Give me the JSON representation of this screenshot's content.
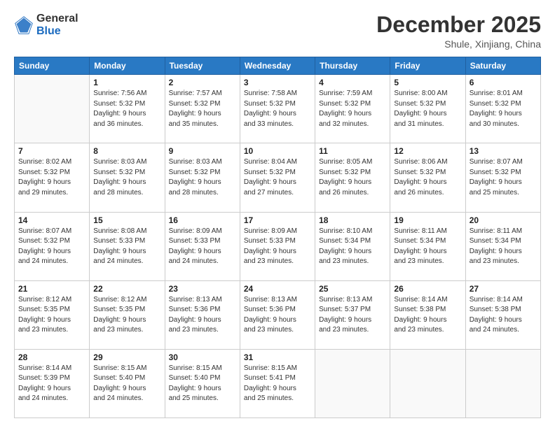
{
  "logo": {
    "general": "General",
    "blue": "Blue"
  },
  "header": {
    "month_year": "December 2025",
    "location": "Shule, Xinjiang, China"
  },
  "weekdays": [
    "Sunday",
    "Monday",
    "Tuesday",
    "Wednesday",
    "Thursday",
    "Friday",
    "Saturday"
  ],
  "weeks": [
    [
      {
        "day": "",
        "info": ""
      },
      {
        "day": "1",
        "info": "Sunrise: 7:56 AM\nSunset: 5:32 PM\nDaylight: 9 hours\nand 36 minutes."
      },
      {
        "day": "2",
        "info": "Sunrise: 7:57 AM\nSunset: 5:32 PM\nDaylight: 9 hours\nand 35 minutes."
      },
      {
        "day": "3",
        "info": "Sunrise: 7:58 AM\nSunset: 5:32 PM\nDaylight: 9 hours\nand 33 minutes."
      },
      {
        "day": "4",
        "info": "Sunrise: 7:59 AM\nSunset: 5:32 PM\nDaylight: 9 hours\nand 32 minutes."
      },
      {
        "day": "5",
        "info": "Sunrise: 8:00 AM\nSunset: 5:32 PM\nDaylight: 9 hours\nand 31 minutes."
      },
      {
        "day": "6",
        "info": "Sunrise: 8:01 AM\nSunset: 5:32 PM\nDaylight: 9 hours\nand 30 minutes."
      }
    ],
    [
      {
        "day": "7",
        "info": "Sunrise: 8:02 AM\nSunset: 5:32 PM\nDaylight: 9 hours\nand 29 minutes."
      },
      {
        "day": "8",
        "info": "Sunrise: 8:03 AM\nSunset: 5:32 PM\nDaylight: 9 hours\nand 28 minutes."
      },
      {
        "day": "9",
        "info": "Sunrise: 8:03 AM\nSunset: 5:32 PM\nDaylight: 9 hours\nand 28 minutes."
      },
      {
        "day": "10",
        "info": "Sunrise: 8:04 AM\nSunset: 5:32 PM\nDaylight: 9 hours\nand 27 minutes."
      },
      {
        "day": "11",
        "info": "Sunrise: 8:05 AM\nSunset: 5:32 PM\nDaylight: 9 hours\nand 26 minutes."
      },
      {
        "day": "12",
        "info": "Sunrise: 8:06 AM\nSunset: 5:32 PM\nDaylight: 9 hours\nand 26 minutes."
      },
      {
        "day": "13",
        "info": "Sunrise: 8:07 AM\nSunset: 5:32 PM\nDaylight: 9 hours\nand 25 minutes."
      }
    ],
    [
      {
        "day": "14",
        "info": "Sunrise: 8:07 AM\nSunset: 5:32 PM\nDaylight: 9 hours\nand 24 minutes."
      },
      {
        "day": "15",
        "info": "Sunrise: 8:08 AM\nSunset: 5:33 PM\nDaylight: 9 hours\nand 24 minutes."
      },
      {
        "day": "16",
        "info": "Sunrise: 8:09 AM\nSunset: 5:33 PM\nDaylight: 9 hours\nand 24 minutes."
      },
      {
        "day": "17",
        "info": "Sunrise: 8:09 AM\nSunset: 5:33 PM\nDaylight: 9 hours\nand 23 minutes."
      },
      {
        "day": "18",
        "info": "Sunrise: 8:10 AM\nSunset: 5:34 PM\nDaylight: 9 hours\nand 23 minutes."
      },
      {
        "day": "19",
        "info": "Sunrise: 8:11 AM\nSunset: 5:34 PM\nDaylight: 9 hours\nand 23 minutes."
      },
      {
        "day": "20",
        "info": "Sunrise: 8:11 AM\nSunset: 5:34 PM\nDaylight: 9 hours\nand 23 minutes."
      }
    ],
    [
      {
        "day": "21",
        "info": "Sunrise: 8:12 AM\nSunset: 5:35 PM\nDaylight: 9 hours\nand 23 minutes."
      },
      {
        "day": "22",
        "info": "Sunrise: 8:12 AM\nSunset: 5:35 PM\nDaylight: 9 hours\nand 23 minutes."
      },
      {
        "day": "23",
        "info": "Sunrise: 8:13 AM\nSunset: 5:36 PM\nDaylight: 9 hours\nand 23 minutes."
      },
      {
        "day": "24",
        "info": "Sunrise: 8:13 AM\nSunset: 5:36 PM\nDaylight: 9 hours\nand 23 minutes."
      },
      {
        "day": "25",
        "info": "Sunrise: 8:13 AM\nSunset: 5:37 PM\nDaylight: 9 hours\nand 23 minutes."
      },
      {
        "day": "26",
        "info": "Sunrise: 8:14 AM\nSunset: 5:38 PM\nDaylight: 9 hours\nand 23 minutes."
      },
      {
        "day": "27",
        "info": "Sunrise: 8:14 AM\nSunset: 5:38 PM\nDaylight: 9 hours\nand 24 minutes."
      }
    ],
    [
      {
        "day": "28",
        "info": "Sunrise: 8:14 AM\nSunset: 5:39 PM\nDaylight: 9 hours\nand 24 minutes."
      },
      {
        "day": "29",
        "info": "Sunrise: 8:15 AM\nSunset: 5:40 PM\nDaylight: 9 hours\nand 24 minutes."
      },
      {
        "day": "30",
        "info": "Sunrise: 8:15 AM\nSunset: 5:40 PM\nDaylight: 9 hours\nand 25 minutes."
      },
      {
        "day": "31",
        "info": "Sunrise: 8:15 AM\nSunset: 5:41 PM\nDaylight: 9 hours\nand 25 minutes."
      },
      {
        "day": "",
        "info": ""
      },
      {
        "day": "",
        "info": ""
      },
      {
        "day": "",
        "info": ""
      }
    ]
  ]
}
